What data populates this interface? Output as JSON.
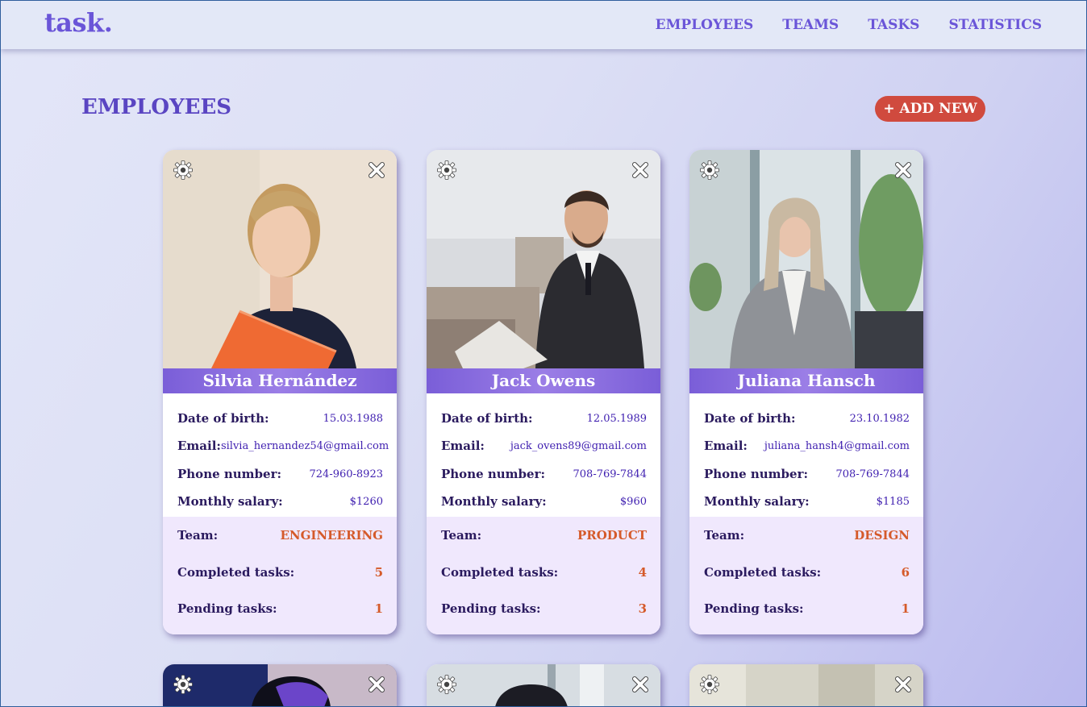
{
  "app": {
    "logo": "task."
  },
  "nav": {
    "items": [
      "EMPLOYEES",
      "TEAMS",
      "TASKS",
      "STATISTICS"
    ]
  },
  "page": {
    "title": "EMPLOYEES",
    "add_button": "+ ADD NEW"
  },
  "labels": {
    "dob": "Date of birth:",
    "email": "Email:",
    "phone": "Phone number:",
    "salary": "Monthly salary:",
    "team": "Team:",
    "completed": "Completed tasks:",
    "pending": "Pending tasks:"
  },
  "colors": {
    "accent": "#6a55d8",
    "add_button": "#d04a3e",
    "stat_value": "#d55a2a"
  },
  "employees": [
    {
      "name": "Silvia Hernández",
      "dob": "15.03.1988",
      "email": "silvia_hernandez54@gmail.com",
      "phone": "724-960-8923",
      "salary": "$1260",
      "team": "ENGINEERING",
      "completed": "5",
      "pending": "1"
    },
    {
      "name": "Jack Owens",
      "dob": "12.05.1989",
      "email": "jack_ovens89@gmail.com",
      "phone": "708-769-7844",
      "salary": "$960",
      "team": "PRODUCT",
      "completed": "4",
      "pending": "3"
    },
    {
      "name": "Juliana Hansch",
      "dob": "23.10.1982",
      "email": "juliana_hansh4@gmail.com",
      "phone": "708-769-7844",
      "salary": "$1185",
      "team": "DESIGN",
      "completed": "6",
      "pending": "1"
    }
  ]
}
